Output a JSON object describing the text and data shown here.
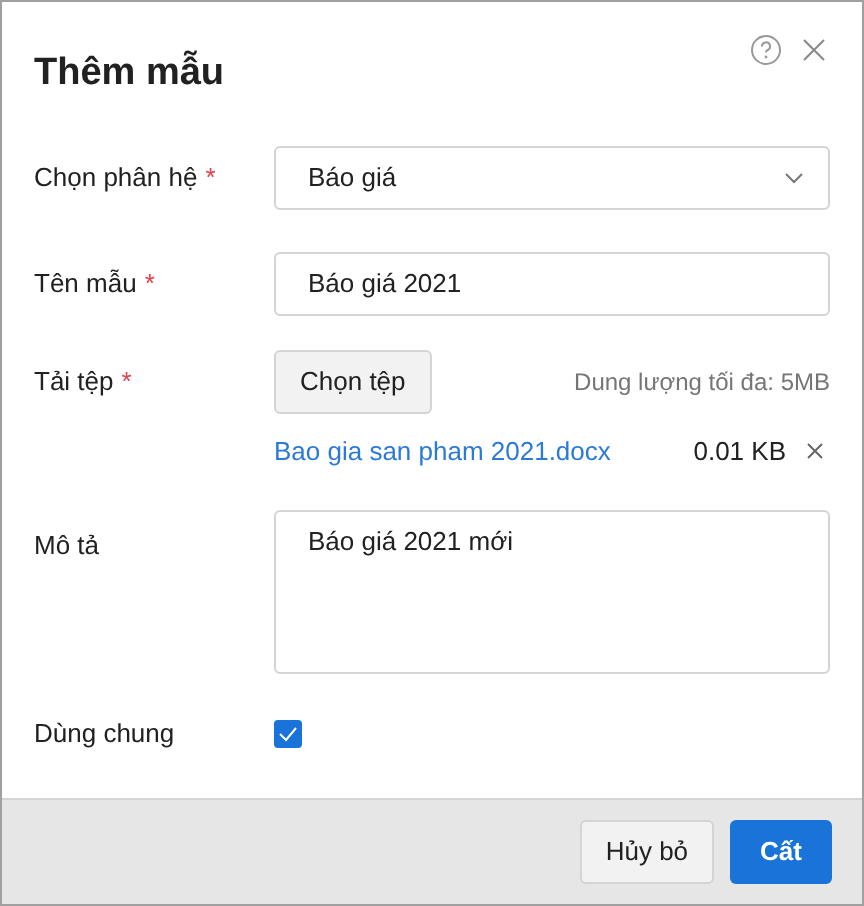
{
  "dialog": {
    "title": "Thêm mẫu"
  },
  "fields": [
    {
      "kind": "select",
      "label": "Chọn phân hệ",
      "required_mark": "*",
      "value": "Báo giá"
    },
    {
      "kind": "text",
      "label": "Tên mẫu",
      "required_mark": "*",
      "value": "Báo giá 2021"
    },
    {
      "kind": "upload",
      "label": "Tải tệp",
      "required_mark": "*",
      "button": "Chọn tệp",
      "hint": "Dung lượng tối đa: 5MB",
      "file_name": "Bao gia san pham 2021.docx",
      "file_size": "0.01 KB"
    },
    {
      "kind": "textarea",
      "label": "Mô tả",
      "value": "Báo giá 2021 mới"
    },
    {
      "kind": "checkbox",
      "label": "Dùng chung",
      "checked": true
    }
  ],
  "footer": {
    "buttons": [
      {
        "label": "Hủy bỏ",
        "primary": false
      },
      {
        "label": "Cất",
        "primary": true
      }
    ]
  }
}
